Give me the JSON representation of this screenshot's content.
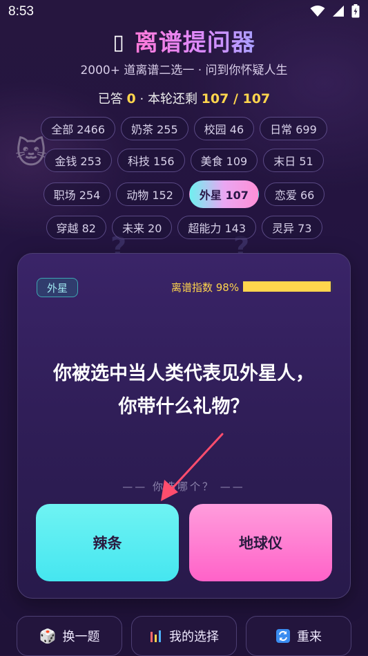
{
  "status_bar": {
    "time": "8:53"
  },
  "header": {
    "title_glyph": "▯",
    "title": "离谱提问器",
    "subtitle": "2000+ 道离谱二选一 · 问到你怀疑人生",
    "progress": {
      "prefix": "已答 ",
      "answered": "0",
      "middle": " · 本轮还剩 ",
      "remaining": "107",
      "sep": " / ",
      "total": "107"
    }
  },
  "categories": [
    [
      {
        "label": "全部 2466"
      },
      {
        "label": "奶茶 255"
      },
      {
        "label": "校园 46"
      },
      {
        "label": "日常 699"
      }
    ],
    [
      {
        "label": "金钱 253"
      },
      {
        "label": "科技 156"
      },
      {
        "label": "美食 109"
      },
      {
        "label": "末日 51"
      }
    ],
    [
      {
        "label": "职场 254"
      },
      {
        "label": "动物 152"
      },
      {
        "label": "外星 107",
        "active": true
      },
      {
        "label": "恋爱 66"
      }
    ],
    [
      {
        "label": "穿越 82"
      },
      {
        "label": "未来 20"
      },
      {
        "label": "超能力 143"
      },
      {
        "label": "灵异 73"
      }
    ]
  ],
  "card": {
    "tag": "外星",
    "absurd_label": "离谱指数 98%",
    "absurd_value": 0.98,
    "question_line1": "你被选中当人类代表见外星人，",
    "question_line2": "你带什么礼物？",
    "prompt": "—— 你选哪个？ ——",
    "option_a": "辣条",
    "option_b": "地球仪"
  },
  "bottom_bar": {
    "skip": "换一题",
    "history": "我的选择",
    "restart": "重来"
  },
  "colors": {
    "accent_yellow": "#ffd54d",
    "option_a": "#45e6f0",
    "option_b": "#ff62c8",
    "arrow": "#ff4d6d"
  }
}
